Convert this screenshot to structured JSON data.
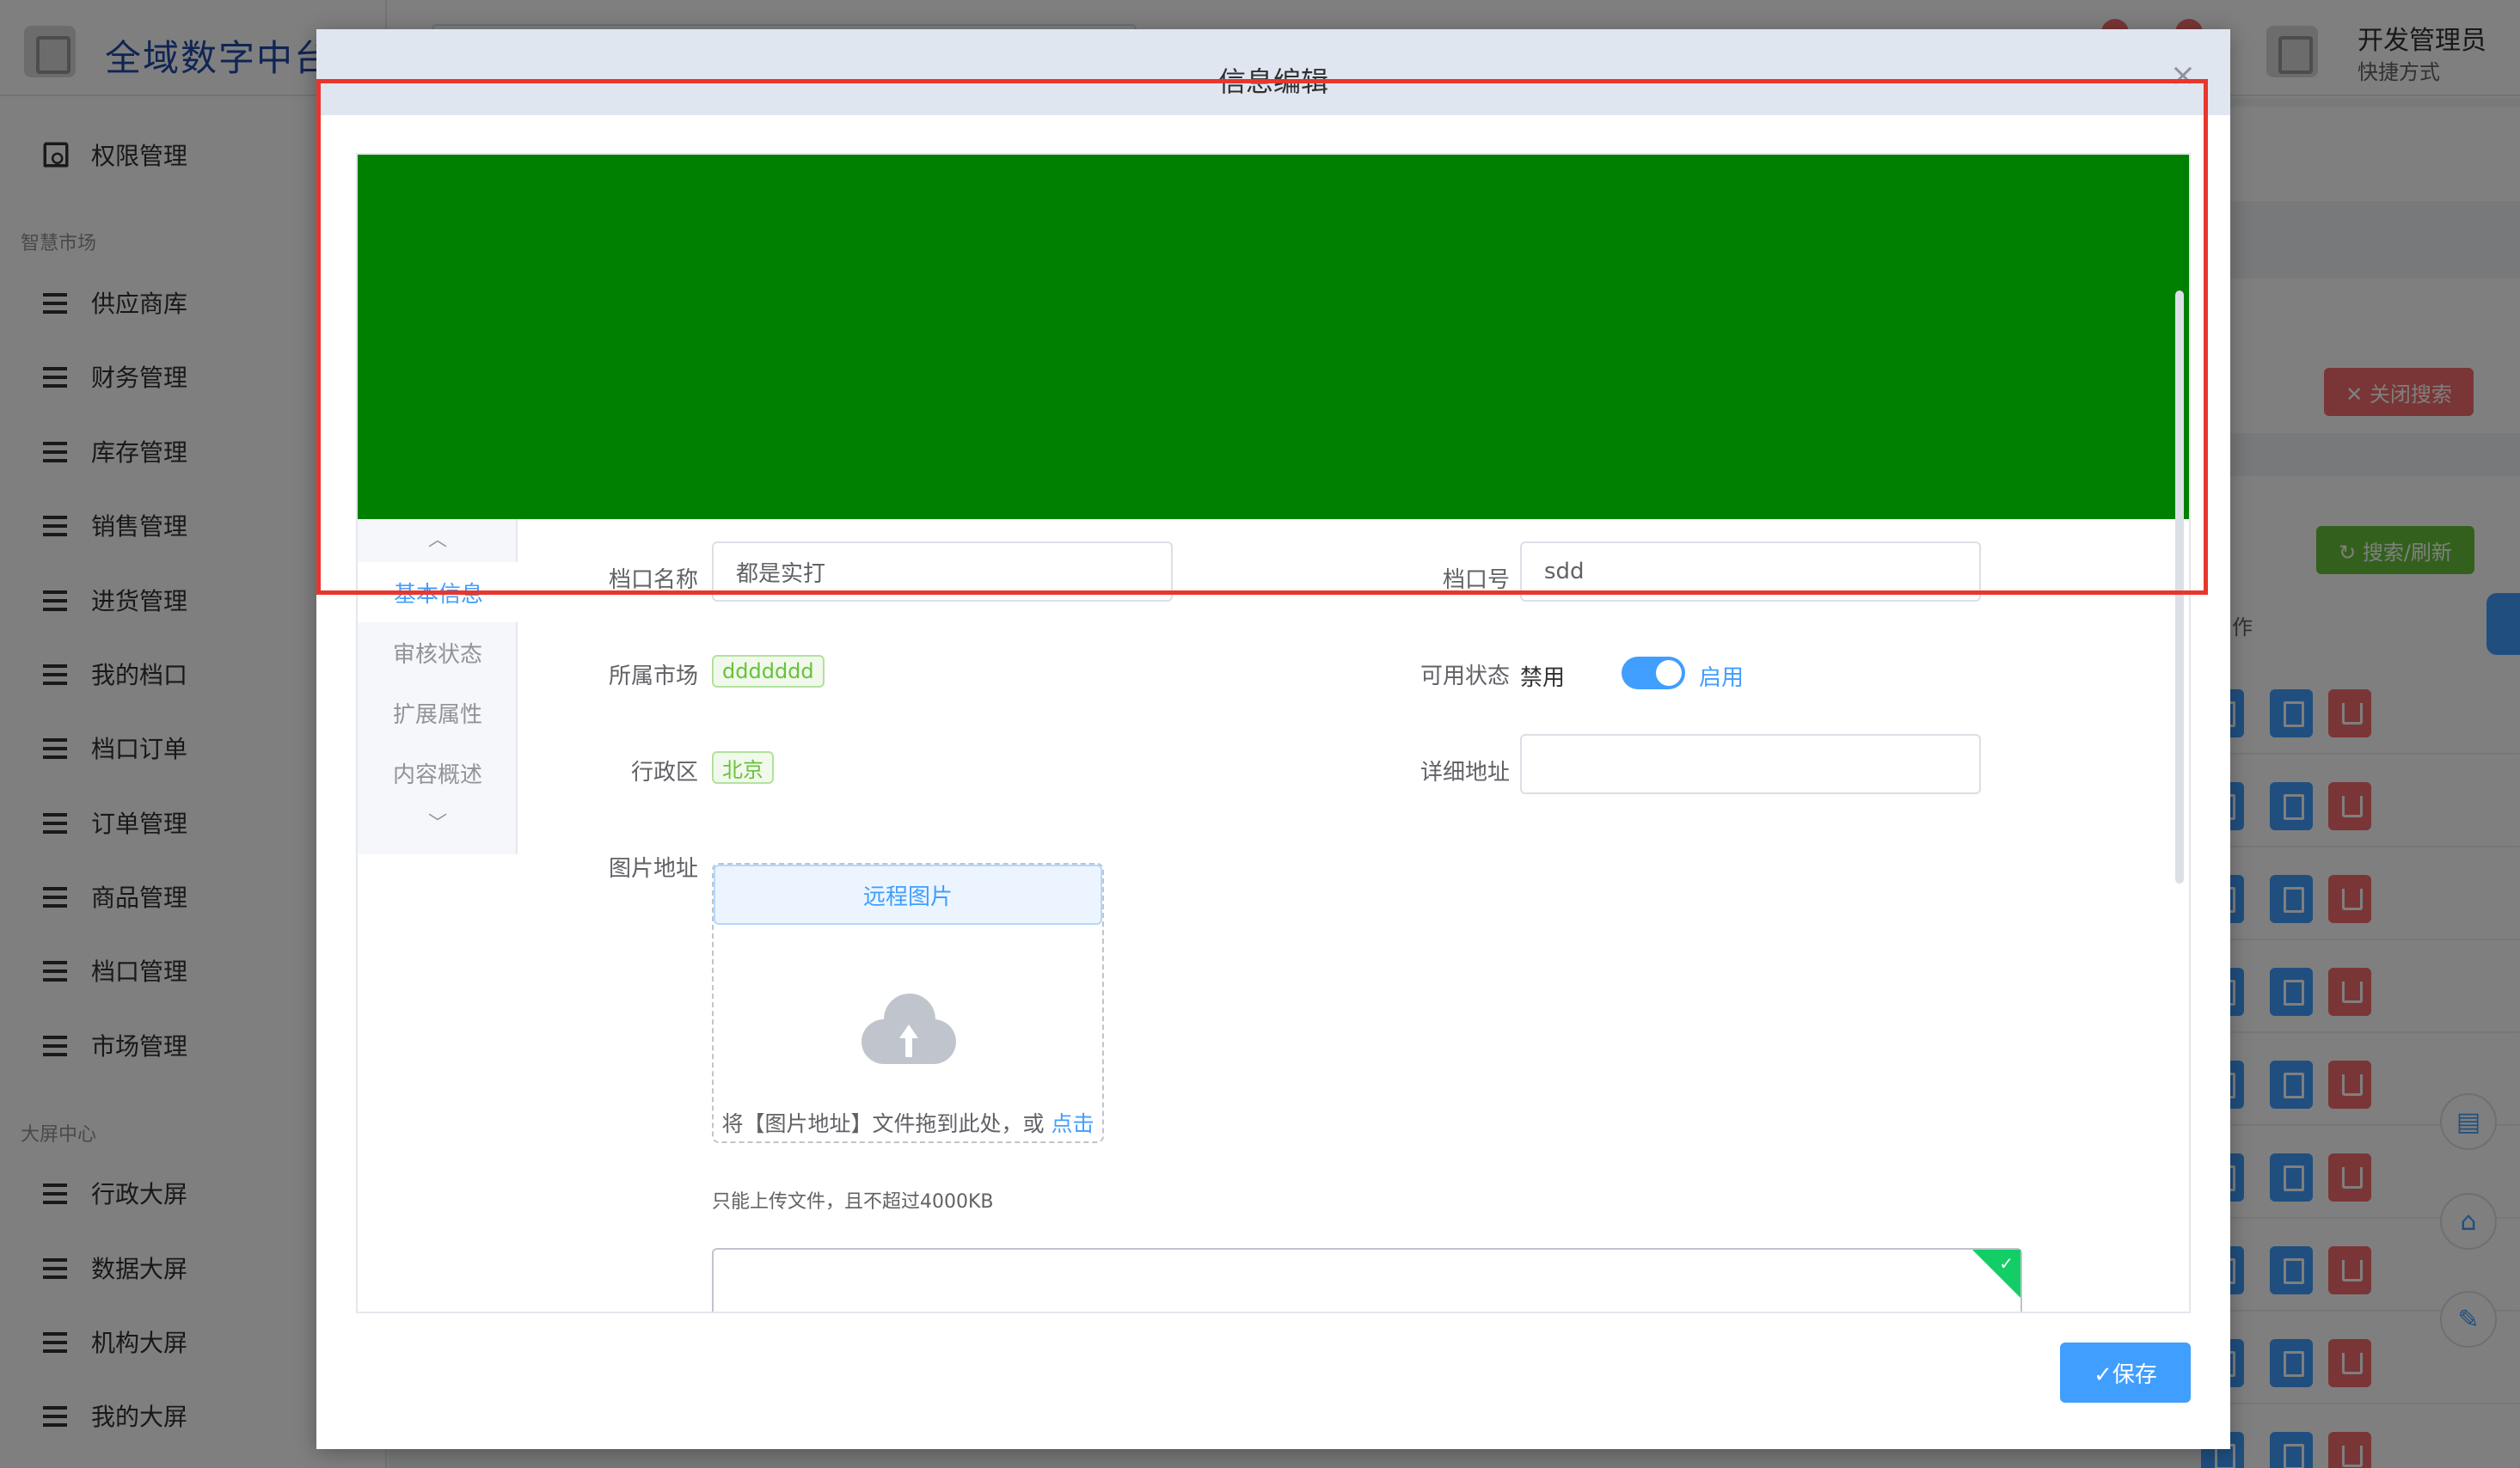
{
  "app": {
    "logo_text": "全域数字中台",
    "user_name": "开发管理员",
    "user_sub": "快捷方式"
  },
  "sidebar": {
    "top_item": "权限管理",
    "groups": [
      {
        "title": "智慧市场",
        "items": [
          "供应商库",
          "财务管理",
          "库存管理",
          "销售管理",
          "进货管理",
          "我的档口",
          "档口订单",
          "订单管理",
          "商品管理",
          "档口管理",
          "市场管理"
        ]
      },
      {
        "title": "大屏中心",
        "items": [
          "行政大屏",
          "数据大屏",
          "机构大屏",
          "我的大屏"
        ]
      }
    ]
  },
  "background": {
    "close_search_label": "✕ 关闭搜索",
    "search_refresh_label": "↻ 搜索/刷新",
    "ops_header": "作"
  },
  "dialog": {
    "title": "信息编辑",
    "close_icon": "×",
    "tabs": [
      "基本信息",
      "审核状态",
      "扩展属性",
      "内容概述"
    ],
    "active_tab": "基本信息",
    "fields": {
      "stall_name_label": "档口名称",
      "stall_name_value": "都是实打",
      "stall_no_label": "档口号",
      "stall_no_value": "sdd",
      "market_label": "所属市场",
      "market_value": "ddddddd",
      "status_label": "可用状态",
      "status_off": "禁用",
      "status_on": "启用",
      "status_enabled": true,
      "region_label": "行政区",
      "region_value": "北京",
      "address_label": "详细地址",
      "address_value": "",
      "image_label": "图片地址"
    },
    "upload": {
      "remote_button": "远程图片",
      "drop_text": "将【图片地址】文件拖到此处，或",
      "click_text": "点击",
      "tip": "只能上传文件，且不超过4000KB"
    },
    "save_label": "✓保存",
    "colors": {
      "banner": "#008000",
      "primary": "#409eff",
      "highlight_frame": "#e8362d"
    }
  }
}
